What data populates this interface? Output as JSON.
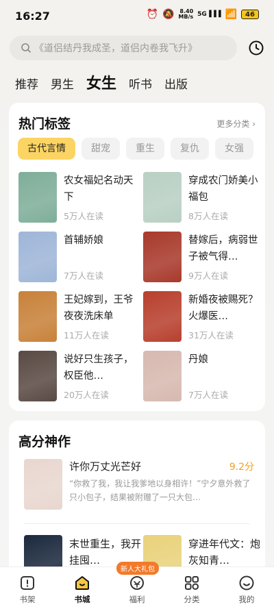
{
  "status_bar": {
    "time": "16:27",
    "net_speed": "8.40",
    "net_unit": "MB/s",
    "signal_label": "5G",
    "battery": "46"
  },
  "search": {
    "placeholder": "《道侣结丹我成圣，道侣内卷我飞升》"
  },
  "category_tabs": [
    {
      "label": "推荐",
      "active": false
    },
    {
      "label": "男生",
      "active": false
    },
    {
      "label": "女生",
      "active": true
    },
    {
      "label": "听书",
      "active": false
    },
    {
      "label": "出版",
      "active": false
    }
  ],
  "hot_tags": {
    "title": "热门标签",
    "more": "更多分类",
    "tags": [
      "古代言情",
      "甜宠",
      "重生",
      "复仇",
      "女强"
    ],
    "books": [
      {
        "title": "农女福妃名动天下",
        "readers": "5万人在读",
        "cover": "#7fae9a"
      },
      {
        "title": "穿成农门娇美小福包",
        "readers": "8万人在读",
        "cover": "#b9d0c4"
      },
      {
        "title": "首辅娇娘",
        "readers": "7万人在读",
        "cover": "#9fb6d8"
      },
      {
        "title": "替嫁后，病弱世子被气得…",
        "readers": "9万人在读",
        "cover": "#a83a2c"
      },
      {
        "title": "王妃嫁到，王爷夜夜洗床单",
        "readers": "11万人在读",
        "cover": "#c8823a"
      },
      {
        "title": "新婚夜被赐死？火爆医…",
        "readers": "31万人在读",
        "cover": "#b8402e"
      },
      {
        "title": "说好只生孩子，权臣他…",
        "readers": "20万人在读",
        "cover": "#5a4a44"
      },
      {
        "title": "丹娘",
        "readers": "7万人在读",
        "cover": "#d7b9b0"
      }
    ]
  },
  "high_score": {
    "title": "高分神作",
    "featured": {
      "title": "许你万丈光芒好",
      "score": "9.2分",
      "desc": "“你救了我，我让我爹地以身相许！”宁夕意外救了只小包子，结果被附赠了一只大包…",
      "cover": "#e8d7cf"
    },
    "row2": [
      {
        "title": "末世重生，我开挂囤…",
        "cover": "#1c2a3e"
      },
      {
        "title": "穿进年代文：炮灰知青…",
        "cover": "#e9d27b"
      }
    ]
  },
  "bottom_nav": {
    "items": [
      {
        "label": "书架",
        "active": false
      },
      {
        "label": "书城",
        "active": true
      },
      {
        "label": "福利",
        "active": false
      },
      {
        "label": "分类",
        "active": false
      },
      {
        "label": "我的",
        "active": false
      }
    ],
    "badge": "新人大礼包"
  }
}
